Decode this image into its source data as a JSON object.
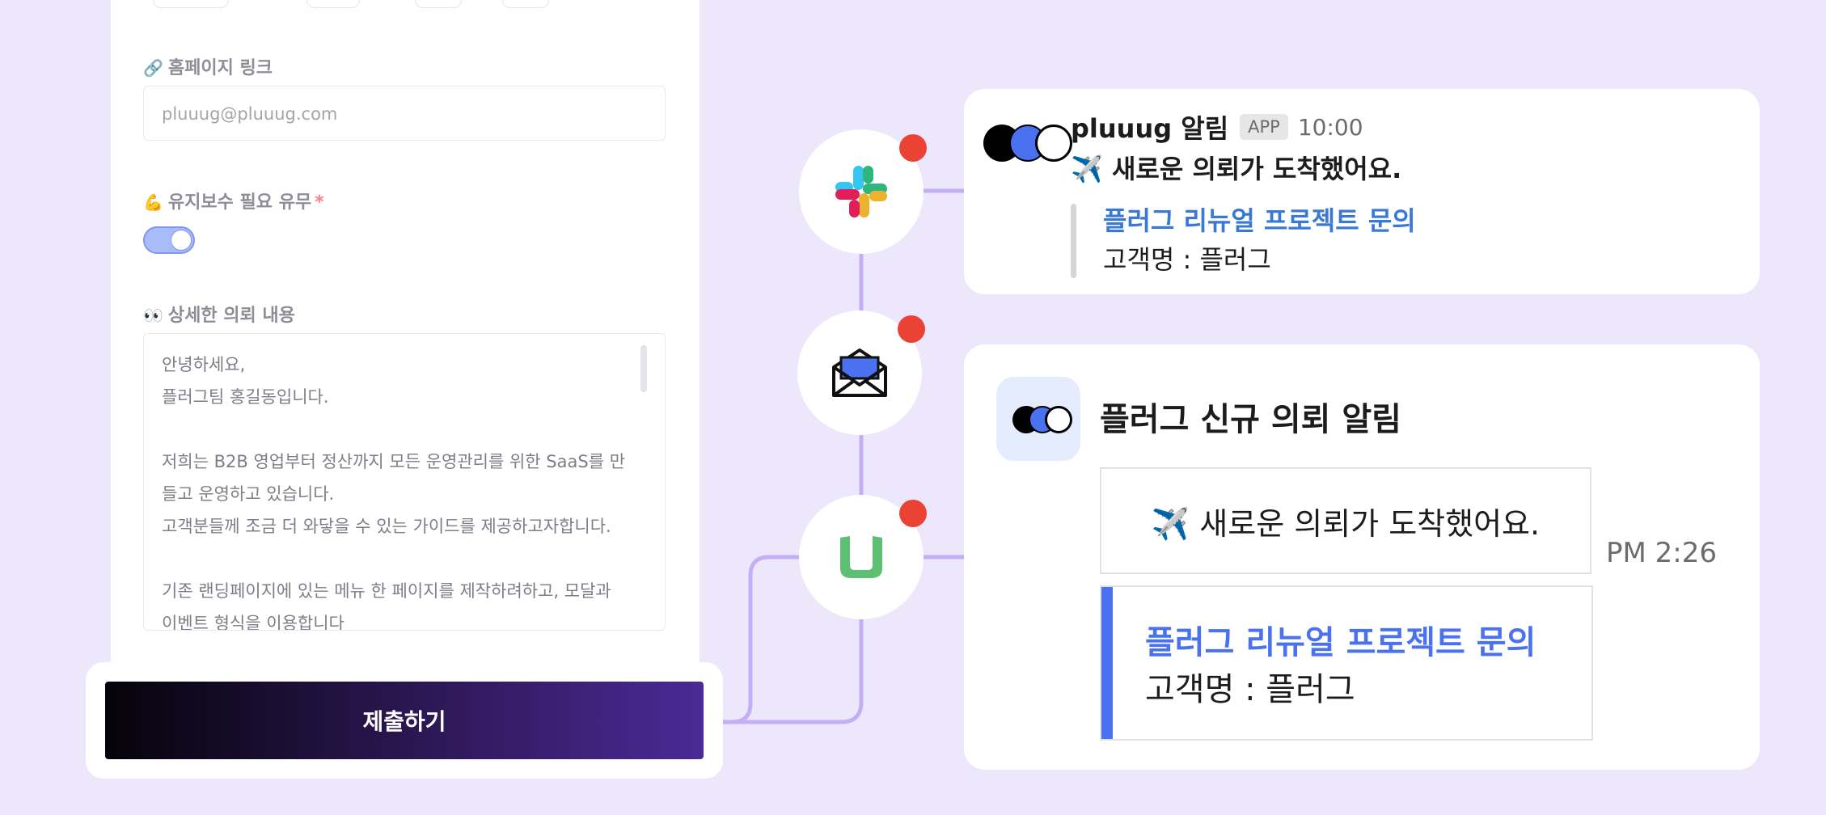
{
  "form": {
    "homepage_label": "홈페이지 링크",
    "homepage_emoji": "🔗",
    "homepage_placeholder": "pluuug@pluuug.com",
    "maintenance_label": "유지보수 필요 유무",
    "maintenance_emoji": "💪",
    "maintenance_required_mark": "*",
    "maintenance_toggle_on": true,
    "details_label": "상세한 의뢰 내용",
    "details_emoji": "👀",
    "details_lines": [
      "안녕하세요,",
      "플러그팀 홍길동입니다.",
      "",
      "저희는 B2B 영업부터 정산까지 모든 운영관리를 위한 SaaS를 만",
      "들고 운영하고 있습니다.",
      "고객분들께 조금 더 와닿을 수 있는 가이드를 제공하고자합니다.",
      "",
      "기존 랜딩페이지에 있는 메뉴 한 페이지를 제작하려하고, 모달과",
      "이벤트 형식을 이용합니다"
    ],
    "submit_label": "제출하기"
  },
  "integrations": {
    "nodes": [
      "slack-icon",
      "mail-icon",
      "jandi-icon"
    ],
    "notification_dot_color": "#ea4335"
  },
  "slack_card": {
    "sender": "pluuug 알림",
    "badge": "APP",
    "time": "10:00",
    "message": "✈️ 새로운 의뢰가 도착했어요.",
    "link": "플러그 리뉴얼 프로젝트 문의",
    "client": "고객명 : 플러그"
  },
  "jandi_card": {
    "title": "플러그 신규 의뢰 알림",
    "message": "✈️ 새로운 의뢰가 도착했어요.",
    "time": "PM 2:26",
    "link": "플러그 리뉴얼 프로젝트 문의",
    "client": "고객명 : 플러그"
  },
  "colors": {
    "background": "#ece7fb",
    "connector": "#c4aef5",
    "slack_link": "#3a78d6",
    "jandi_accent": "#4a71f0",
    "submit_gradient_end": "#4a2a96"
  }
}
